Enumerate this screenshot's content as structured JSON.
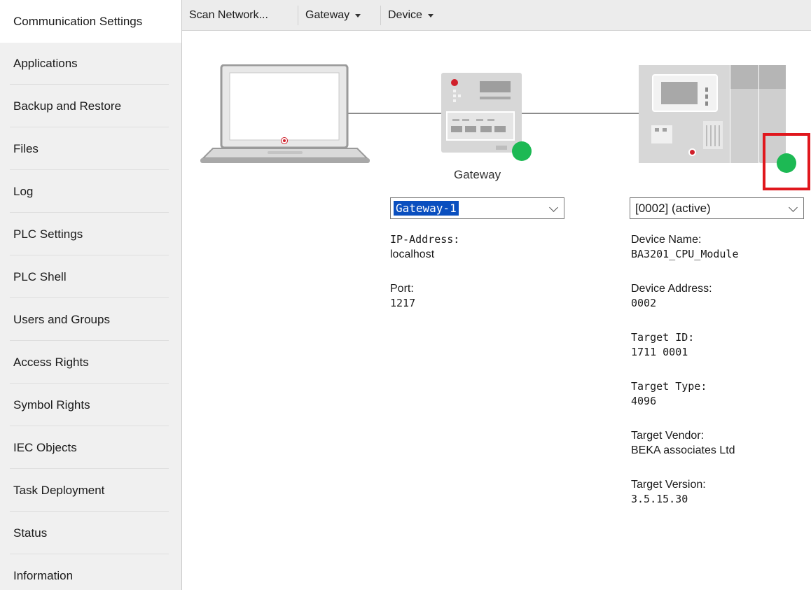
{
  "sidebar": {
    "items": [
      {
        "label": "Communication Settings"
      },
      {
        "label": "Applications"
      },
      {
        "label": "Backup and Restore"
      },
      {
        "label": "Files"
      },
      {
        "label": "Log"
      },
      {
        "label": "PLC Settings"
      },
      {
        "label": "PLC Shell"
      },
      {
        "label": "Users and Groups"
      },
      {
        "label": "Access Rights"
      },
      {
        "label": "Symbol Rights"
      },
      {
        "label": "IEC Objects"
      },
      {
        "label": "Task Deployment"
      },
      {
        "label": "Status"
      },
      {
        "label": "Information"
      }
    ]
  },
  "toolbar": {
    "scan_label": "Scan Network...",
    "gateway_label": "Gateway",
    "device_label": "Device"
  },
  "diagram": {
    "gateway_label": "Gateway",
    "status_color": "#1db954",
    "highlight_color": "#e0171d"
  },
  "gateway_panel": {
    "selected": "Gateway-1",
    "ip_label": "IP-Address:",
    "ip_value": "localhost",
    "port_label": "Port:",
    "port_value": "1217"
  },
  "device_panel": {
    "selected": "[0002] (active)",
    "name_label": "Device Name:",
    "name_value": "BA3201_CPU_Module",
    "address_label": "Device Address:",
    "address_value": "0002",
    "target_id_label": "Target ID:",
    "target_id_value": "1711 0001",
    "target_type_label": "Target Type:",
    "target_type_value": "4096",
    "vendor_label": "Target Vendor:",
    "vendor_value": "BEKA associates Ltd",
    "version_label": "Target Version:",
    "version_value": "3.5.15.30"
  }
}
